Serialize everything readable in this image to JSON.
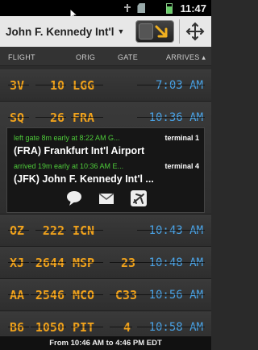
{
  "status_bar": {
    "time": "11:47",
    "icons": [
      "usb-icon",
      "sd-card-icon",
      "signal-icon",
      "battery-icon"
    ]
  },
  "top_bar": {
    "airport": "John F. Kennedy Int'l"
  },
  "columns": {
    "flight": "FLIGHT",
    "orig": "ORIG",
    "gate": "GATE",
    "arrives": "ARRIVES ▴"
  },
  "flights": [
    {
      "airline": "3V",
      "number": "10",
      "origin": "LGG",
      "gate": "",
      "arrives": "7:03 AM"
    },
    {
      "airline": "SQ",
      "number": "26",
      "origin": "FRA",
      "gate": "",
      "arrives": "10:36 AM"
    },
    {
      "airline": "OZ",
      "number": "222",
      "origin": "ICN",
      "gate": "",
      "arrives": "10:43 AM"
    },
    {
      "airline": "XJ",
      "number": "2644",
      "origin": "MSP",
      "gate": "23",
      "arrives": "10:48 AM"
    },
    {
      "airline": "AA",
      "number": "2546",
      "origin": "MCO",
      "gate": "C33",
      "arrives": "10:56 AM"
    },
    {
      "airline": "B6",
      "number": "1050",
      "origin": "PIT",
      "gate": "4",
      "arrives": "10:58 AM"
    }
  ],
  "details": {
    "departure": "left gate 8m early at 8:22 AM G...",
    "departure_terminal": "terminal 1",
    "origin_airport": "(FRA) Frankfurt Int'l Airport",
    "arrival": "arrived 19m early at 10:36 AM E...",
    "arrival_terminal": "terminal 4",
    "destination_airport": "(JFK) John F. Kennedy Int'l ..."
  },
  "footer": {
    "range": "From 10:46 AM to 4:46 PM EDT"
  },
  "colors": {
    "tile_text": "#f0a21c",
    "time_text": "#4aa3e6",
    "status_green": "#4ecb3a"
  }
}
